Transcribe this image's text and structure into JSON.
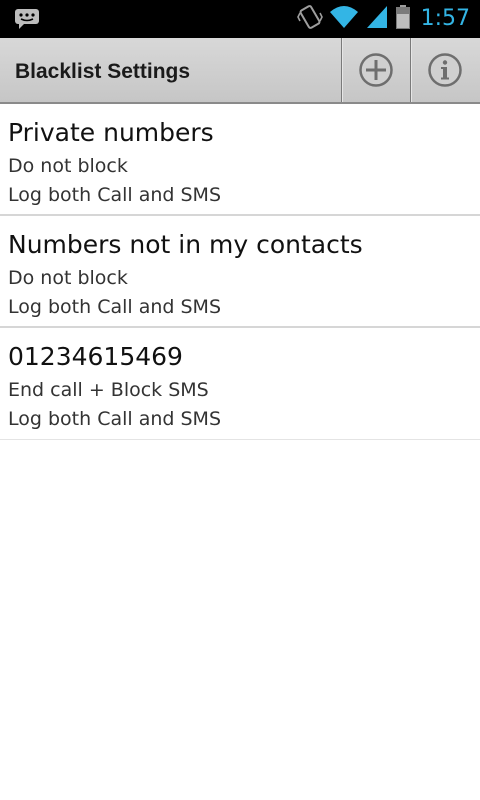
{
  "status_bar": {
    "time": "1:57",
    "notification_icon": "sms-icon",
    "icons": [
      "vibrate-icon",
      "wifi-icon",
      "signal-icon",
      "battery-icon"
    ],
    "clock_color": "#33b5e5"
  },
  "action_bar": {
    "title": "Blacklist Settings",
    "actions": [
      {
        "name": "add",
        "icon": "add-circle-icon"
      },
      {
        "name": "info",
        "icon": "info-circle-icon"
      }
    ]
  },
  "rules": [
    {
      "name": "Private numbers",
      "action": "Do not block",
      "log": "Log both Call and SMS"
    },
    {
      "name": "Numbers not in my contacts",
      "action": "Do not block",
      "log": "Log both Call and SMS"
    },
    {
      "name": "01234615469",
      "action": "End call + Block SMS",
      "log": "Log both Call and SMS"
    }
  ]
}
